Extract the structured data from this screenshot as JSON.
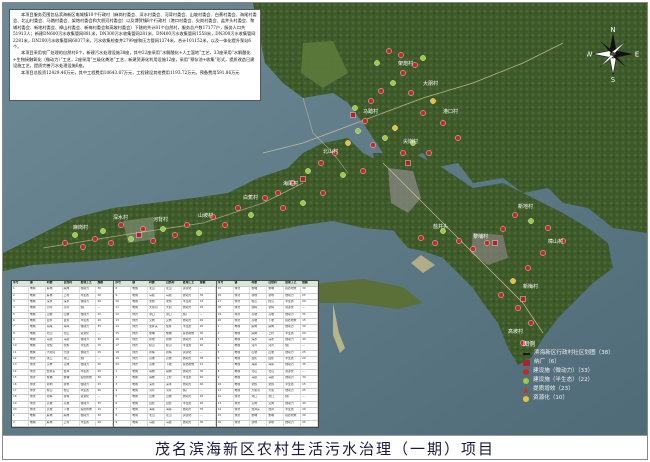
{
  "title": "茂名滨海新区农村生活污水治理（一期）项目",
  "description": {
    "paragraphs": [
      "本项目服务范围包括滨海新区电城镇10个行政村（麻岗村委会、深水村委会、河背村委会、山坡村委会、白蕉村委会、海尾村委会、北山村委会、马踏村委会、架炮村委会和大朋河村委会）以及博贺镇8个行政村（港口村委会、尖岗村委会、盐井头村委会、黎埔村委会、新地村委会、樟山村委会、新梅村委会和高坡村委会）下辖的共计81个自然村，服务总户数17177户，服务人口共51913人；新建DN600污水收集管网881米，DN300污水收集管网281米，DN400污水收集管网1558米，DN300污水收集管网2281米，DN200污水收集管网68377米，污水收集检查井2799座和压力管网1374米，合计101152米，以及一体化提升泵站6个。",
      "本项目采用农厂处理的自然村6个，新建污水处理设施38座，其中22座采用“水解酸化+人工湿地”工艺，33座采用“水解酸化+生物接触氧化（微动力）”工艺，2座采用“三级化粪池”工艺，新建资源化利用设施12座，采用“预存池+收集”形式，提质改造已建设施工艺，提质完善污水处理设施6座。",
      "本项目总投资12429.46万元，其中工程费用10643.87万元，工程建设其他费用1193.72万元，预备费用591.86万元"
    ]
  },
  "compass": {
    "n": "N",
    "s": "S",
    "e": "E",
    "w": "W"
  },
  "legend": {
    "title": "图例",
    "items": [
      {
        "label": "滨海新区行政村社区划图（38）",
        "color": "#1a1a1a",
        "shape": "line"
      },
      {
        "label": "纳厂（6）",
        "color": "#b3202a",
        "shape": "square"
      },
      {
        "label": "建设施（微动力）（33）",
        "color": "#c62828",
        "shape": "dot"
      },
      {
        "label": "建设施（半生态）（22）",
        "color": "#9ccc3a",
        "shape": "dot"
      },
      {
        "label": "提质增效（23）",
        "color": "#c0392b",
        "shape": "triangle"
      },
      {
        "label": "资源化（10）",
        "color": "#e8c233",
        "shape": "dot"
      }
    ]
  },
  "place_labels": [
    "麻岗村",
    "深水村",
    "河背村",
    "山坡村",
    "白蕉村",
    "海尾村",
    "北山村",
    "马踏村",
    "架炮村",
    "大朋村",
    "港口村",
    "尖岗村",
    "盐井头",
    "黎埔村",
    "新地村",
    "樟山村",
    "新梅村",
    "高坡村"
  ],
  "table": {
    "headers": [
      "序号",
      "镇",
      "村委",
      "自然村",
      "处理工艺",
      "规模"
    ],
    "rows": [
      [
        "1",
        "电城",
        "麻岗",
        "麻岗",
        "微动力",
        "30"
      ],
      [
        "2",
        "电城",
        "麻岗",
        "上村",
        "半生态",
        "20"
      ],
      [
        "3",
        "电城",
        "深水",
        "深水",
        "微动力",
        "40"
      ],
      [
        "4",
        "电城",
        "河背",
        "河背",
        "纳厂",
        "—"
      ],
      [
        "5",
        "电城",
        "山坡",
        "山坡",
        "微动力",
        "25"
      ],
      [
        "6",
        "电城",
        "白蕉",
        "白蕉",
        "半生态",
        "20"
      ],
      [
        "7",
        "电城",
        "海尾",
        "海尾",
        "微动力",
        "35"
      ],
      [
        "8",
        "电城",
        "北山",
        "北山",
        "资源化",
        "—"
      ],
      [
        "9",
        "电城",
        "马踏",
        "马踏",
        "微动力",
        "30"
      ],
      [
        "10",
        "电城",
        "架炮",
        "架炮",
        "半生态",
        "15"
      ],
      [
        "11",
        "电城",
        "大朋河",
        "大朋",
        "微动力",
        "25"
      ],
      [
        "12",
        "博贺",
        "港口",
        "港口",
        "纳厂",
        "—"
      ],
      [
        "13",
        "博贺",
        "尖岗",
        "尖岗",
        "微动力",
        "40"
      ],
      [
        "14",
        "博贺",
        "盐井头",
        "盐井",
        "半生态",
        "20"
      ],
      [
        "15",
        "博贺",
        "黎埔",
        "黎埔",
        "提质增效",
        "30"
      ],
      [
        "16",
        "博贺",
        "新地",
        "新地",
        "微动力",
        "25"
      ],
      [
        "17",
        "博贺",
        "樟山",
        "樟山",
        "半生态",
        "20"
      ],
      [
        "18",
        "博贺",
        "新梅",
        "新梅",
        "资源化",
        "—"
      ],
      [
        "19",
        "博贺",
        "高坡",
        "高坡",
        "微动力",
        "35"
      ],
      [
        "20",
        "博贺",
        "高坡",
        "下坡",
        "提质增效",
        "15"
      ]
    ]
  }
}
